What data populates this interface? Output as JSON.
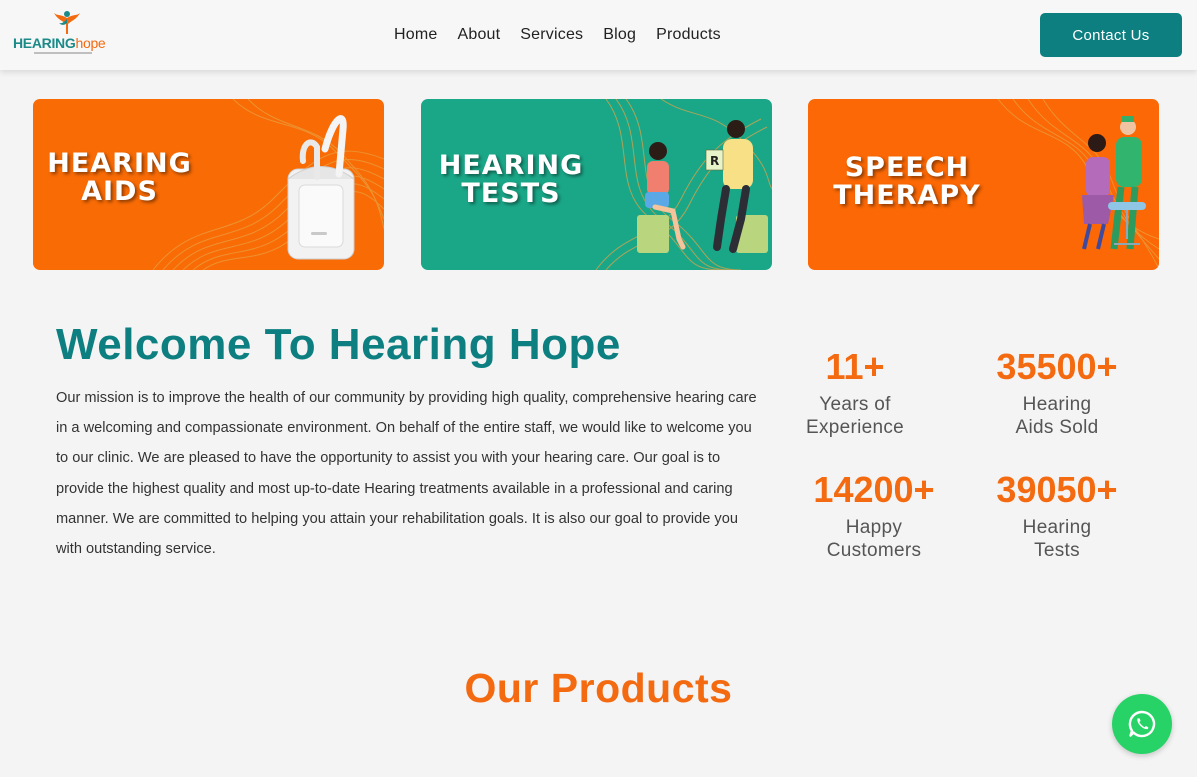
{
  "header": {
    "logo": {
      "word1": "HEARING",
      "word2": "hope"
    },
    "nav": [
      "Home",
      "About",
      "Services",
      "Blog",
      "Products"
    ],
    "contact_label": "Contact Us"
  },
  "banners": [
    {
      "title_line1": "HEARING",
      "title_line2": "AIDS",
      "color": "#f96b05"
    },
    {
      "title_line1": "HEARING",
      "title_line2": "TESTS",
      "color": "#1aa788"
    },
    {
      "title_line1": "SPEECH",
      "title_line2": "THERAPY",
      "color": "#fb6805"
    }
  ],
  "welcome": {
    "title": "Welcome To Hearing Hope",
    "text": "Our mission is to improve the health of our community by providing high quality, comprehensive hearing care in a welcoming and compassionate environment. On behalf of the entire staff, we would like to welcome you to our clinic. We are pleased to have the opportunity to assist you with your hearing care. Our goal is to provide the highest quality and most up-to-date Hearing treatments available in a professional and caring manner. We are committed to helping you attain your rehabilitation goals. It is also our goal to provide you with outstanding service."
  },
  "stats": [
    {
      "value": "11+",
      "label_line1": "Years of",
      "label_line2": "Experience"
    },
    {
      "value": "35500+",
      "label_line1": "Hearing",
      "label_line2": "Aids Sold"
    },
    {
      "value": "14200+",
      "label_line1": "Happy",
      "label_line2": "Customers"
    },
    {
      "value": "39050+",
      "label_line1": "Hearing",
      "label_line2": "Tests"
    }
  ],
  "products_title": "Our Products",
  "colors": {
    "teal": "#0d7f80",
    "orange": "#f36a10",
    "whatsapp": "#27d366"
  },
  "icons": {
    "whatsapp": "whatsapp-icon"
  }
}
